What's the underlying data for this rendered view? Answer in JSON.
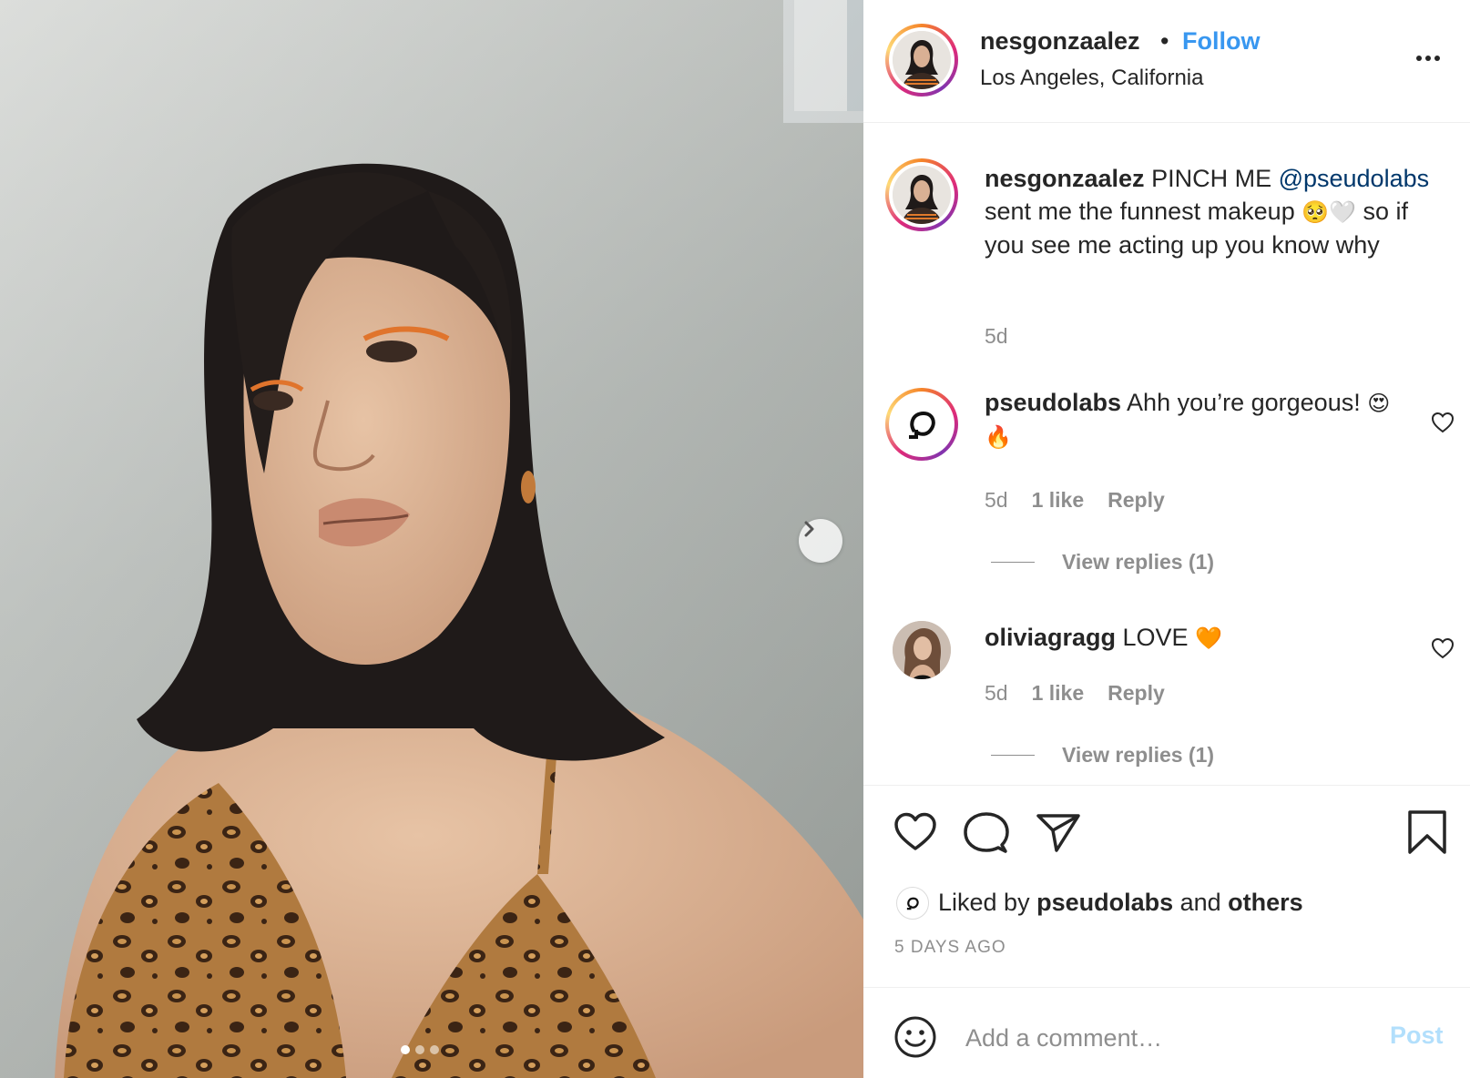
{
  "post": {
    "username": "nesgonzaalez",
    "separator": "•",
    "follow_label": "Follow",
    "location": "Los Angeles, California",
    "more_label": "...",
    "caption": {
      "username": "nesgonzaalez",
      "text_before": " PINCH ME ",
      "mention": "@pseudolabs",
      "text_mid": " sent me the funnest makeup ",
      "emoji": "🥺🤍",
      "text_after": " so if you see me acting up you know why",
      "time": "5d"
    },
    "comments": [
      {
        "username": "pseudolabs",
        "text": " Ahh you’re gorgeous! ",
        "emoji": "😍🔥",
        "time": "5d",
        "likes": "1 like",
        "reply_label": "Reply",
        "view_replies": "View replies (1)"
      },
      {
        "username": "oliviagragg",
        "text": " LOVE ",
        "emoji": "🧡",
        "time": "5d",
        "likes": "1 like",
        "reply_label": "Reply",
        "view_replies": "View replies (1)"
      }
    ],
    "liked_by": {
      "prefix": "Liked by ",
      "user": "pseudolabs",
      "middle": " and ",
      "others": "others"
    },
    "time_ago": "5 DAYS AGO",
    "comment_box": {
      "placeholder": "Add a comment…",
      "post_label": "Post"
    },
    "carousel": {
      "current": 1,
      "total": 3
    }
  },
  "colors": {
    "accent": "#3897f0",
    "mention": "#00376b",
    "muted": "#8e8e8e",
    "post_disabled": "#b2dffc"
  },
  "icons": [
    "chevron-right-icon",
    "more-icon",
    "heart-icon",
    "comment-icon",
    "share-icon",
    "bookmark-icon",
    "smiley-icon",
    "pseudolabs-logo-icon"
  ]
}
